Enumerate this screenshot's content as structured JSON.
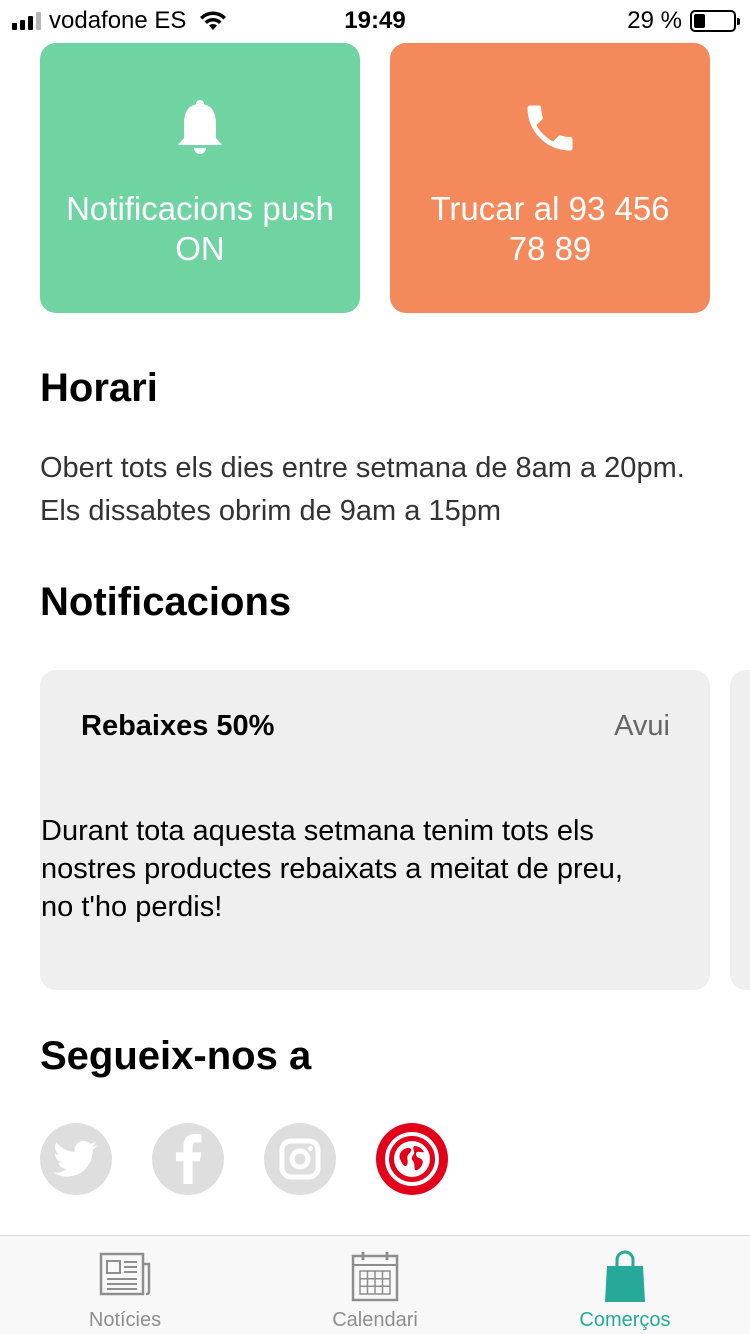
{
  "status_bar": {
    "carrier": "vodafone ES",
    "time": "19:49",
    "battery_percent": "29 %",
    "battery_level": 0.29
  },
  "tiles": {
    "notifications_label": "Notificacions push ON",
    "call_label": "Trucar al 93 456 78 89",
    "notifications_color": "#6fd4a2",
    "call_color": "#f4895c"
  },
  "schedule": {
    "title": "Horari",
    "text": "Obert tots els dies entre setmana de 8am a 20pm. Els dissabtes obrim de 9am a 15pm"
  },
  "notifications": {
    "title": "Notificacions",
    "items": [
      {
        "title": "Rebaixes 50%",
        "date": "Avui",
        "body": "Durant tota aquesta setmana tenim tots els nostres productes rebaixats a meitat de preu, no t'ho perdis!"
      }
    ]
  },
  "follow": {
    "title": "Segueix-nos a",
    "icons": [
      "twitter-icon",
      "facebook-icon",
      "instagram-icon",
      "web-globe-icon"
    ]
  },
  "tab_bar": {
    "tabs": [
      {
        "label": "Notícies",
        "icon": "newspaper-icon",
        "active": false
      },
      {
        "label": "Calendari",
        "icon": "calendar-icon",
        "active": false
      },
      {
        "label": "Comerços",
        "icon": "shopping-bag-icon",
        "active": true
      }
    ],
    "active_color": "#27a99a",
    "inactive_color": "#8e8e8e"
  }
}
